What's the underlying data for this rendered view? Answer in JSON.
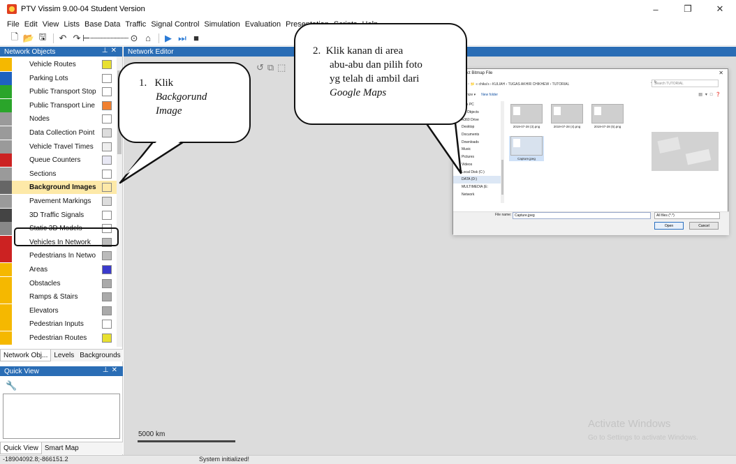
{
  "app": {
    "title": "PTV Vissim 9.00-04 Student Version",
    "window_controls": [
      "–",
      "❐",
      "✕"
    ]
  },
  "menu": [
    "File",
    "Edit",
    "View",
    "Lists",
    "Base Data",
    "Traffic",
    "Signal Control",
    "Simulation",
    "Evaluation",
    "Presentation",
    "Scripts",
    "Help"
  ],
  "network_objects": {
    "header": "Network Objects",
    "items": [
      {
        "label": "Vehicle Routes",
        "icon_color": "#f5b800",
        "swatch": "#e8e030"
      },
      {
        "label": "Parking Lots",
        "icon_color": "#1e62c0",
        "swatch": "#ffffff"
      },
      {
        "label": "Public Transport Stop",
        "icon_color": "#2aa52a",
        "swatch": "#ffffff"
      },
      {
        "label": "Public Transport Line",
        "icon_color": "#2aa52a",
        "swatch": "#f08030"
      },
      {
        "label": "Nodes",
        "icon_color": "#9a9a9a",
        "swatch": "#ffffff"
      },
      {
        "label": "Data Collection Point",
        "icon_color": "#9a9a9a",
        "swatch": "#dddddd"
      },
      {
        "label": "Vehicle Travel Times",
        "icon_color": "#9a9a9a",
        "swatch": "#eeeeee"
      },
      {
        "label": "Queue Counters",
        "icon_color": "#cc2222",
        "swatch": "#e8e8f4"
      },
      {
        "label": "Sections",
        "icon_color": "#9a9a9a",
        "swatch": "#ffffff"
      },
      {
        "label": "Background Images",
        "icon_color": "#666666",
        "swatch": "#fde9a8"
      },
      {
        "label": "Pavement Markings",
        "icon_color": "#9a9a9a",
        "swatch": "#dddddd"
      },
      {
        "label": "3D Traffic Signals",
        "icon_color": "#444444",
        "swatch": "#ffffff"
      },
      {
        "label": "Static 3D Models",
        "icon_color": "#888888",
        "swatch": "#ffffff"
      },
      {
        "label": "Vehicles In Network",
        "icon_color": "#cc2222",
        "swatch": "#bbbbbb"
      },
      {
        "label": "Pedestrians In Netwo",
        "icon_color": "#cc2222",
        "swatch": "#bbbbbb"
      },
      {
        "label": "Areas",
        "icon_color": "#f5b800",
        "swatch": "#3a3acc"
      },
      {
        "label": "Obstacles",
        "icon_color": "#f5b800",
        "swatch": "#aaaaaa"
      },
      {
        "label": "Ramps & Stairs",
        "icon_color": "#f5b800",
        "swatch": "#aaaaaa"
      },
      {
        "label": "Elevators",
        "icon_color": "#f5b800",
        "swatch": "#aaaaaa"
      },
      {
        "label": "Pedestrian Inputs",
        "icon_color": "#f5b800",
        "swatch": "#ffffff"
      },
      {
        "label": "Pedestrian Routes",
        "icon_color": "#f5b800",
        "swatch": "#e8e030"
      }
    ],
    "selected_index": 9,
    "tabs": [
      "Network Obj...",
      "Levels",
      "Backgrounds"
    ]
  },
  "quick_view": {
    "header": "Quick View",
    "tabs": [
      "Quick View",
      "Smart Map"
    ]
  },
  "editor": {
    "header": "Network Editor",
    "scale_label": "5000 km",
    "watermark_title": "Activate Windows",
    "watermark_sub": "Go to Settings to activate Windows."
  },
  "dialog": {
    "title": "Select Bitmap File",
    "close": "✕",
    "path": [
      "chika's",
      "KULIAH",
      "TUGAS AKHIR CHIKHEW",
      "TUTORIAL"
    ],
    "search_placeholder": "Search TUTORIAL",
    "organize": "Organize ▾",
    "new_folder": "New folder",
    "nav_items": [
      "This PC",
      "3D Objects",
      "A360 Drive",
      "Desktop",
      "Documents",
      "Downloads",
      "Music",
      "Pictures",
      "Videos",
      "Local Disk (C:)",
      "DATA (D:)",
      "MULTIMEDIA (E:",
      "Network"
    ],
    "selected_nav": "DATA (D:)",
    "files": [
      "2019-07-28 (3).png",
      "2019-07-28 (4).png",
      "2019-07-28 (5).png",
      "Capture.jpeg"
    ],
    "selected_file": "Capture.jpeg",
    "file_name_label": "File name:",
    "file_name_value": "Capture.jpeg",
    "file_type": "All files (*.*)",
    "open_label": "Open",
    "cancel_label": "Cancel"
  },
  "callouts": {
    "c1_number": "1.",
    "c1_line1": "Klik",
    "c1_line2": "Backgorund",
    "c1_line3": "Image",
    "c2_number": "2.",
    "c2_line1": "Klik kanan di area",
    "c2_line2": "abu-abu dan pilih foto",
    "c2_line3": "yg telah di ambil dari",
    "c2_line4": "Google Maps"
  },
  "status": {
    "coords": "-18904092.8;-866151.2",
    "message": "System initialized!"
  }
}
